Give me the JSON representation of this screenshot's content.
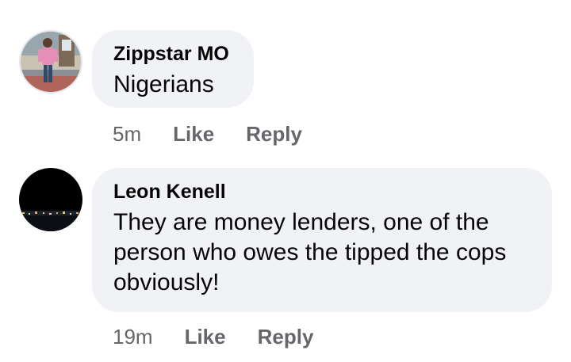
{
  "comments": [
    {
      "author": "Zippstar MO",
      "text": "Nigerians",
      "time": "5m",
      "like_label": "Like",
      "reply_label": "Reply"
    },
    {
      "author": "Leon Kenell",
      "text": "They are money lenders, one of the person who owes the tipped the cops obviously!",
      "time": "19m",
      "like_label": "Like",
      "reply_label": "Reply"
    }
  ],
  "colors": {
    "bubble_bg": "#f0f2f5",
    "text": "#050505",
    "meta": "#65676b"
  }
}
